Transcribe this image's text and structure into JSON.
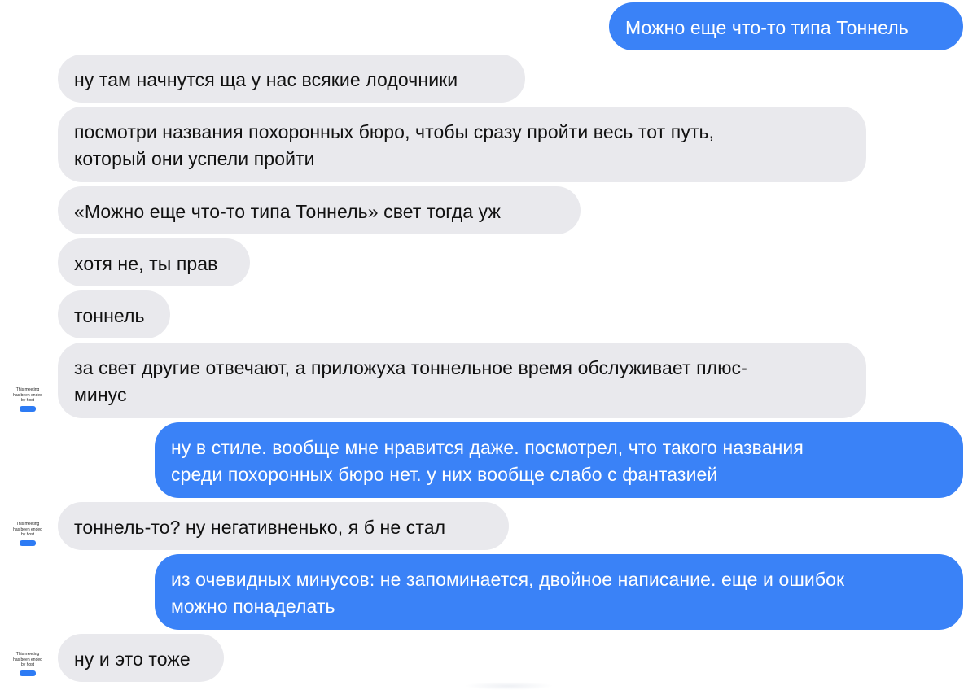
{
  "colors": {
    "incoming_bg": "#e9e9ed",
    "outgoing_bg": "#3a82f7"
  },
  "avatar": {
    "caption_line1": "This meeting",
    "caption_line2": "has been ended",
    "caption_line3": "by host"
  },
  "messages": [
    {
      "side": "out",
      "lines": [
        "Можно еще что-то типа Тоннель"
      ]
    },
    {
      "side": "in",
      "lines": [
        "ну там начнутся ща у нас всякие лодочники"
      ]
    },
    {
      "side": "in",
      "lines": [
        "посмотри названия похоронных бюро, чтобы сразу пройти весь тот путь,",
        "который они успели пройти"
      ]
    },
    {
      "side": "in",
      "lines": [
        "«Можно еще что-то типа Тоннель» свет тогда уж"
      ]
    },
    {
      "side": "in",
      "lines": [
        "хотя не, ты прав"
      ]
    },
    {
      "side": "in",
      "lines": [
        "тоннель"
      ]
    },
    {
      "side": "in",
      "lines": [
        "за свет другие отвечают, а приложуха тоннельное время обслуживает плюс-",
        "минус"
      ]
    },
    {
      "side": "out",
      "lines": [
        "ну в стиле. вообще мне нравится даже. посмотрел, что такого названия",
        "среди похоронных бюро нет. у них вообще слабо с фантазией"
      ]
    },
    {
      "side": "in",
      "lines": [
        "тоннель-то? ну негативненько, я б не стал"
      ]
    },
    {
      "side": "out",
      "lines": [
        "из очевидных минусов: не запоминается, двойное написание. еще и ошибок",
        "можно понаделать"
      ]
    },
    {
      "side": "in",
      "lines": [
        "ну и это тоже"
      ]
    }
  ]
}
